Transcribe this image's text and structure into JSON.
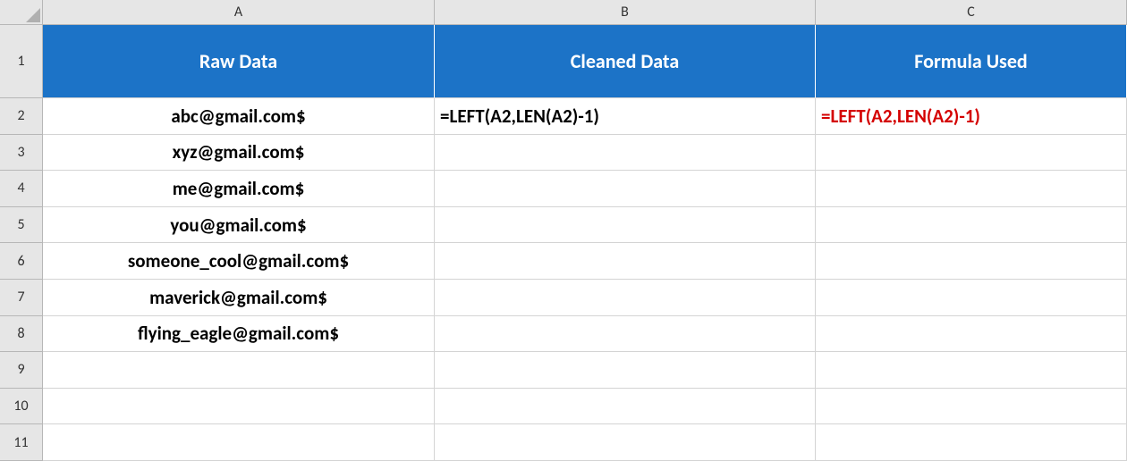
{
  "columns": [
    "A",
    "B",
    "C"
  ],
  "rows": [
    "1",
    "2",
    "3",
    "4",
    "5",
    "6",
    "7",
    "8",
    "9",
    "10",
    "11"
  ],
  "headers": {
    "A": "Raw Data",
    "B": "Cleaned Data",
    "C": "Formula Used"
  },
  "data": {
    "A2": "abc@gmail.com$",
    "A3": "xyz@gmail.com$",
    "A4": "me@gmail.com$",
    "A5": "you@gmail.com$",
    "A6": "someone_cool@gmail.com$",
    "A7": "maverick@gmail.com$",
    "A8": "flying_eagle@gmail.com$",
    "B2": "=LEFT(A2,LEN(A2)-1)",
    "C2": "=LEFT(A2,LEN(A2)-1)"
  }
}
